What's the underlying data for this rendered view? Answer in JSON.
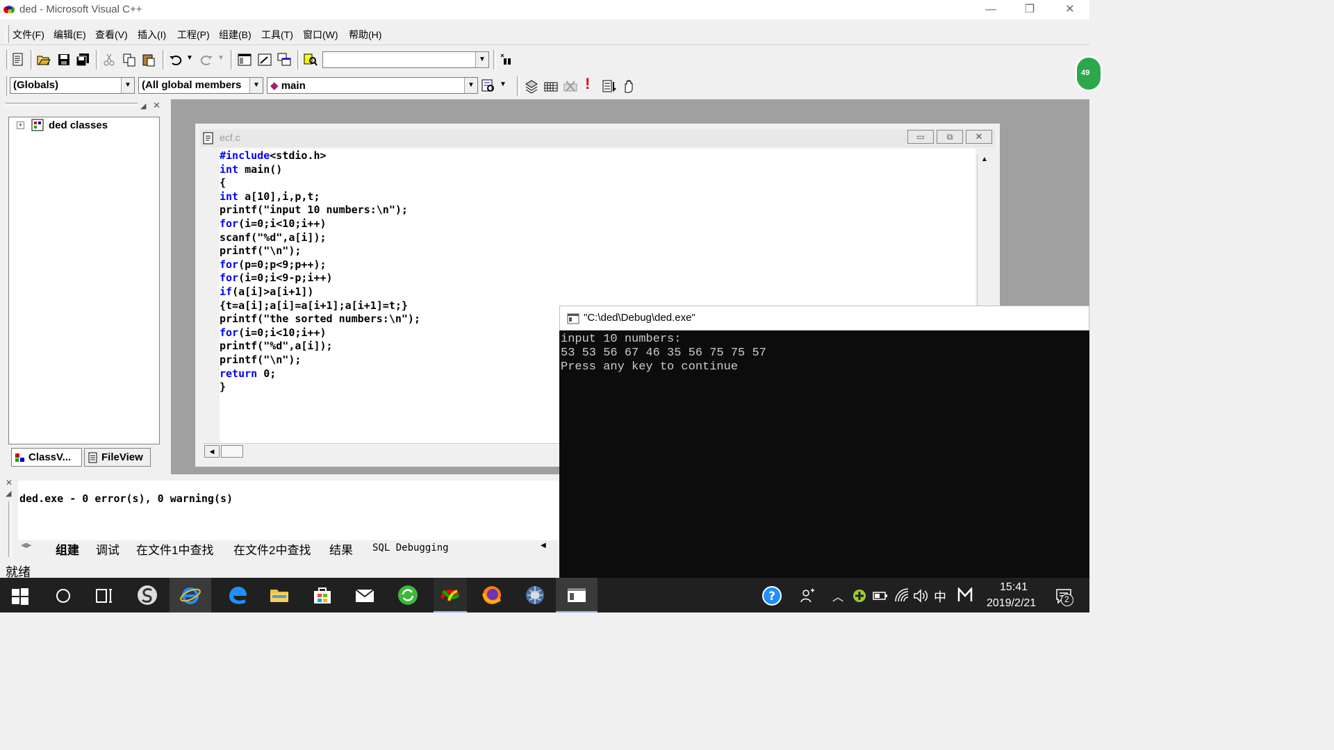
{
  "window": {
    "title": "ded - Microsoft Visual C++",
    "buttons": {
      "minimize": "—",
      "restore": "❐",
      "close": "✕"
    }
  },
  "menu": [
    "文件(F)",
    "编辑(E)",
    "查看(V)",
    "插入(I)",
    "工程(P)",
    "组建(B)",
    "工具(T)",
    "窗口(W)",
    "帮助(H)"
  ],
  "combos": {
    "globals": "(Globals)",
    "members": "(All global members",
    "function": "main"
  },
  "left_panel": {
    "tree_root": "ded classes",
    "tabs": [
      "ClassV...",
      "FileView"
    ]
  },
  "editor": {
    "title": "ecf.c",
    "lines": [
      {
        "parts": [
          {
            "t": "#include",
            "kw": true
          },
          {
            "t": "<stdio.h>",
            "kw": false
          }
        ]
      },
      {
        "parts": [
          {
            "t": "int",
            "kw": true
          },
          {
            "t": " main()",
            "kw": false
          }
        ]
      },
      {
        "parts": [
          {
            "t": "{",
            "kw": false
          }
        ]
      },
      {
        "parts": [
          {
            "t": "int",
            "kw": true
          },
          {
            "t": " a[10],i,p,t;",
            "kw": false
          }
        ]
      },
      {
        "parts": [
          {
            "t": "printf(\"input 10 numbers:\\n\");",
            "kw": false
          }
        ]
      },
      {
        "parts": [
          {
            "t": "for",
            "kw": true
          },
          {
            "t": "(i=0;i<10;i++)",
            "kw": false
          }
        ]
      },
      {
        "parts": [
          {
            "t": "scanf(\"%d\",a[i]);",
            "kw": false
          }
        ]
      },
      {
        "parts": [
          {
            "t": "printf(\"\\n\");",
            "kw": false
          }
        ]
      },
      {
        "parts": [
          {
            "t": "for",
            "kw": true
          },
          {
            "t": "(p=0;p<9;p++);",
            "kw": false
          }
        ]
      },
      {
        "parts": [
          {
            "t": "for",
            "kw": true
          },
          {
            "t": "(i=0;i<9-p;i++)",
            "kw": false
          }
        ]
      },
      {
        "parts": [
          {
            "t": "if",
            "kw": true
          },
          {
            "t": "(a[i]>a[i+1])",
            "kw": false
          }
        ]
      },
      {
        "parts": [
          {
            "t": "{t=a[i];a[i]=a[i+1];a[i+1]=t;}",
            "kw": false
          }
        ]
      },
      {
        "parts": [
          {
            "t": "printf(\"the sorted numbers:\\n\");",
            "kw": false
          }
        ]
      },
      {
        "parts": [
          {
            "t": "for",
            "kw": true
          },
          {
            "t": "(i=0;i<10;i++)",
            "kw": false
          }
        ]
      },
      {
        "parts": [
          {
            "t": "printf(\"%d\",a[i]);",
            "kw": false
          }
        ]
      },
      {
        "parts": [
          {
            "t": "printf(\"\\n\");",
            "kw": false
          }
        ]
      },
      {
        "parts": [
          {
            "t": "return",
            "kw": true
          },
          {
            "t": " 0;",
            "kw": false
          }
        ]
      },
      {
        "parts": [
          {
            "t": "}",
            "kw": false
          }
        ]
      }
    ]
  },
  "console": {
    "title": "\"C:\\ded\\Debug\\ded.exe\"",
    "lines": [
      "input 10 numbers:",
      "53 53 56 67 46 35 56 75 75 57",
      "Press any key to continue"
    ]
  },
  "output": {
    "text": "ded.exe - 0 error(s), 0 warning(s)",
    "tabs": [
      "组建",
      "调试",
      "在文件1中查找",
      "在文件2中查找",
      "结果",
      "SQL Debugging"
    ]
  },
  "status": "就绪",
  "taskbar": {
    "time": "15:41",
    "date": "2019/2/21",
    "ime": "中",
    "notif_count": "2",
    "side_badge": "49"
  },
  "colors": {
    "keyword": "#0000ff",
    "console_bg": "#0c0c0c",
    "taskbar": "#202020"
  }
}
